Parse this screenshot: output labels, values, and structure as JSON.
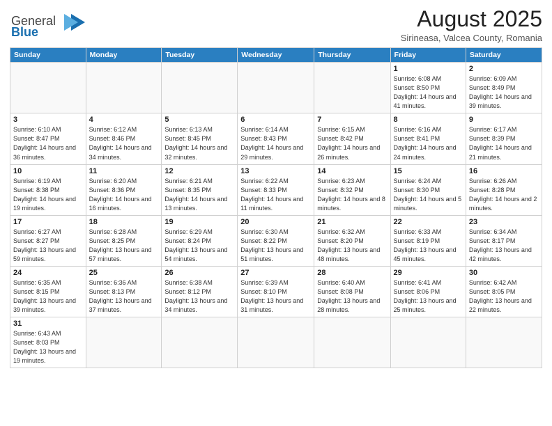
{
  "header": {
    "logo_general": "General",
    "logo_blue": "Blue",
    "title": "August 2025",
    "subtitle": "Sirineasa, Valcea County, Romania"
  },
  "days_of_week": [
    "Sunday",
    "Monday",
    "Tuesday",
    "Wednesday",
    "Thursday",
    "Friday",
    "Saturday"
  ],
  "weeks": [
    [
      {
        "num": "",
        "info": ""
      },
      {
        "num": "",
        "info": ""
      },
      {
        "num": "",
        "info": ""
      },
      {
        "num": "",
        "info": ""
      },
      {
        "num": "",
        "info": ""
      },
      {
        "num": "1",
        "info": "Sunrise: 6:08 AM\nSunset: 8:50 PM\nDaylight: 14 hours and 41 minutes."
      },
      {
        "num": "2",
        "info": "Sunrise: 6:09 AM\nSunset: 8:49 PM\nDaylight: 14 hours and 39 minutes."
      }
    ],
    [
      {
        "num": "3",
        "info": "Sunrise: 6:10 AM\nSunset: 8:47 PM\nDaylight: 14 hours and 36 minutes."
      },
      {
        "num": "4",
        "info": "Sunrise: 6:12 AM\nSunset: 8:46 PM\nDaylight: 14 hours and 34 minutes."
      },
      {
        "num": "5",
        "info": "Sunrise: 6:13 AM\nSunset: 8:45 PM\nDaylight: 14 hours and 32 minutes."
      },
      {
        "num": "6",
        "info": "Sunrise: 6:14 AM\nSunset: 8:43 PM\nDaylight: 14 hours and 29 minutes."
      },
      {
        "num": "7",
        "info": "Sunrise: 6:15 AM\nSunset: 8:42 PM\nDaylight: 14 hours and 26 minutes."
      },
      {
        "num": "8",
        "info": "Sunrise: 6:16 AM\nSunset: 8:41 PM\nDaylight: 14 hours and 24 minutes."
      },
      {
        "num": "9",
        "info": "Sunrise: 6:17 AM\nSunset: 8:39 PM\nDaylight: 14 hours and 21 minutes."
      }
    ],
    [
      {
        "num": "10",
        "info": "Sunrise: 6:19 AM\nSunset: 8:38 PM\nDaylight: 14 hours and 19 minutes."
      },
      {
        "num": "11",
        "info": "Sunrise: 6:20 AM\nSunset: 8:36 PM\nDaylight: 14 hours and 16 minutes."
      },
      {
        "num": "12",
        "info": "Sunrise: 6:21 AM\nSunset: 8:35 PM\nDaylight: 14 hours and 13 minutes."
      },
      {
        "num": "13",
        "info": "Sunrise: 6:22 AM\nSunset: 8:33 PM\nDaylight: 14 hours and 11 minutes."
      },
      {
        "num": "14",
        "info": "Sunrise: 6:23 AM\nSunset: 8:32 PM\nDaylight: 14 hours and 8 minutes."
      },
      {
        "num": "15",
        "info": "Sunrise: 6:24 AM\nSunset: 8:30 PM\nDaylight: 14 hours and 5 minutes."
      },
      {
        "num": "16",
        "info": "Sunrise: 6:26 AM\nSunset: 8:28 PM\nDaylight: 14 hours and 2 minutes."
      }
    ],
    [
      {
        "num": "17",
        "info": "Sunrise: 6:27 AM\nSunset: 8:27 PM\nDaylight: 13 hours and 59 minutes."
      },
      {
        "num": "18",
        "info": "Sunrise: 6:28 AM\nSunset: 8:25 PM\nDaylight: 13 hours and 57 minutes."
      },
      {
        "num": "19",
        "info": "Sunrise: 6:29 AM\nSunset: 8:24 PM\nDaylight: 13 hours and 54 minutes."
      },
      {
        "num": "20",
        "info": "Sunrise: 6:30 AM\nSunset: 8:22 PM\nDaylight: 13 hours and 51 minutes."
      },
      {
        "num": "21",
        "info": "Sunrise: 6:32 AM\nSunset: 8:20 PM\nDaylight: 13 hours and 48 minutes."
      },
      {
        "num": "22",
        "info": "Sunrise: 6:33 AM\nSunset: 8:19 PM\nDaylight: 13 hours and 45 minutes."
      },
      {
        "num": "23",
        "info": "Sunrise: 6:34 AM\nSunset: 8:17 PM\nDaylight: 13 hours and 42 minutes."
      }
    ],
    [
      {
        "num": "24",
        "info": "Sunrise: 6:35 AM\nSunset: 8:15 PM\nDaylight: 13 hours and 39 minutes."
      },
      {
        "num": "25",
        "info": "Sunrise: 6:36 AM\nSunset: 8:13 PM\nDaylight: 13 hours and 37 minutes."
      },
      {
        "num": "26",
        "info": "Sunrise: 6:38 AM\nSunset: 8:12 PM\nDaylight: 13 hours and 34 minutes."
      },
      {
        "num": "27",
        "info": "Sunrise: 6:39 AM\nSunset: 8:10 PM\nDaylight: 13 hours and 31 minutes."
      },
      {
        "num": "28",
        "info": "Sunrise: 6:40 AM\nSunset: 8:08 PM\nDaylight: 13 hours and 28 minutes."
      },
      {
        "num": "29",
        "info": "Sunrise: 6:41 AM\nSunset: 8:06 PM\nDaylight: 13 hours and 25 minutes."
      },
      {
        "num": "30",
        "info": "Sunrise: 6:42 AM\nSunset: 8:05 PM\nDaylight: 13 hours and 22 minutes."
      }
    ],
    [
      {
        "num": "31",
        "info": "Sunrise: 6:43 AM\nSunset: 8:03 PM\nDaylight: 13 hours and 19 minutes."
      },
      {
        "num": "",
        "info": ""
      },
      {
        "num": "",
        "info": ""
      },
      {
        "num": "",
        "info": ""
      },
      {
        "num": "",
        "info": ""
      },
      {
        "num": "",
        "info": ""
      },
      {
        "num": "",
        "info": ""
      }
    ]
  ]
}
